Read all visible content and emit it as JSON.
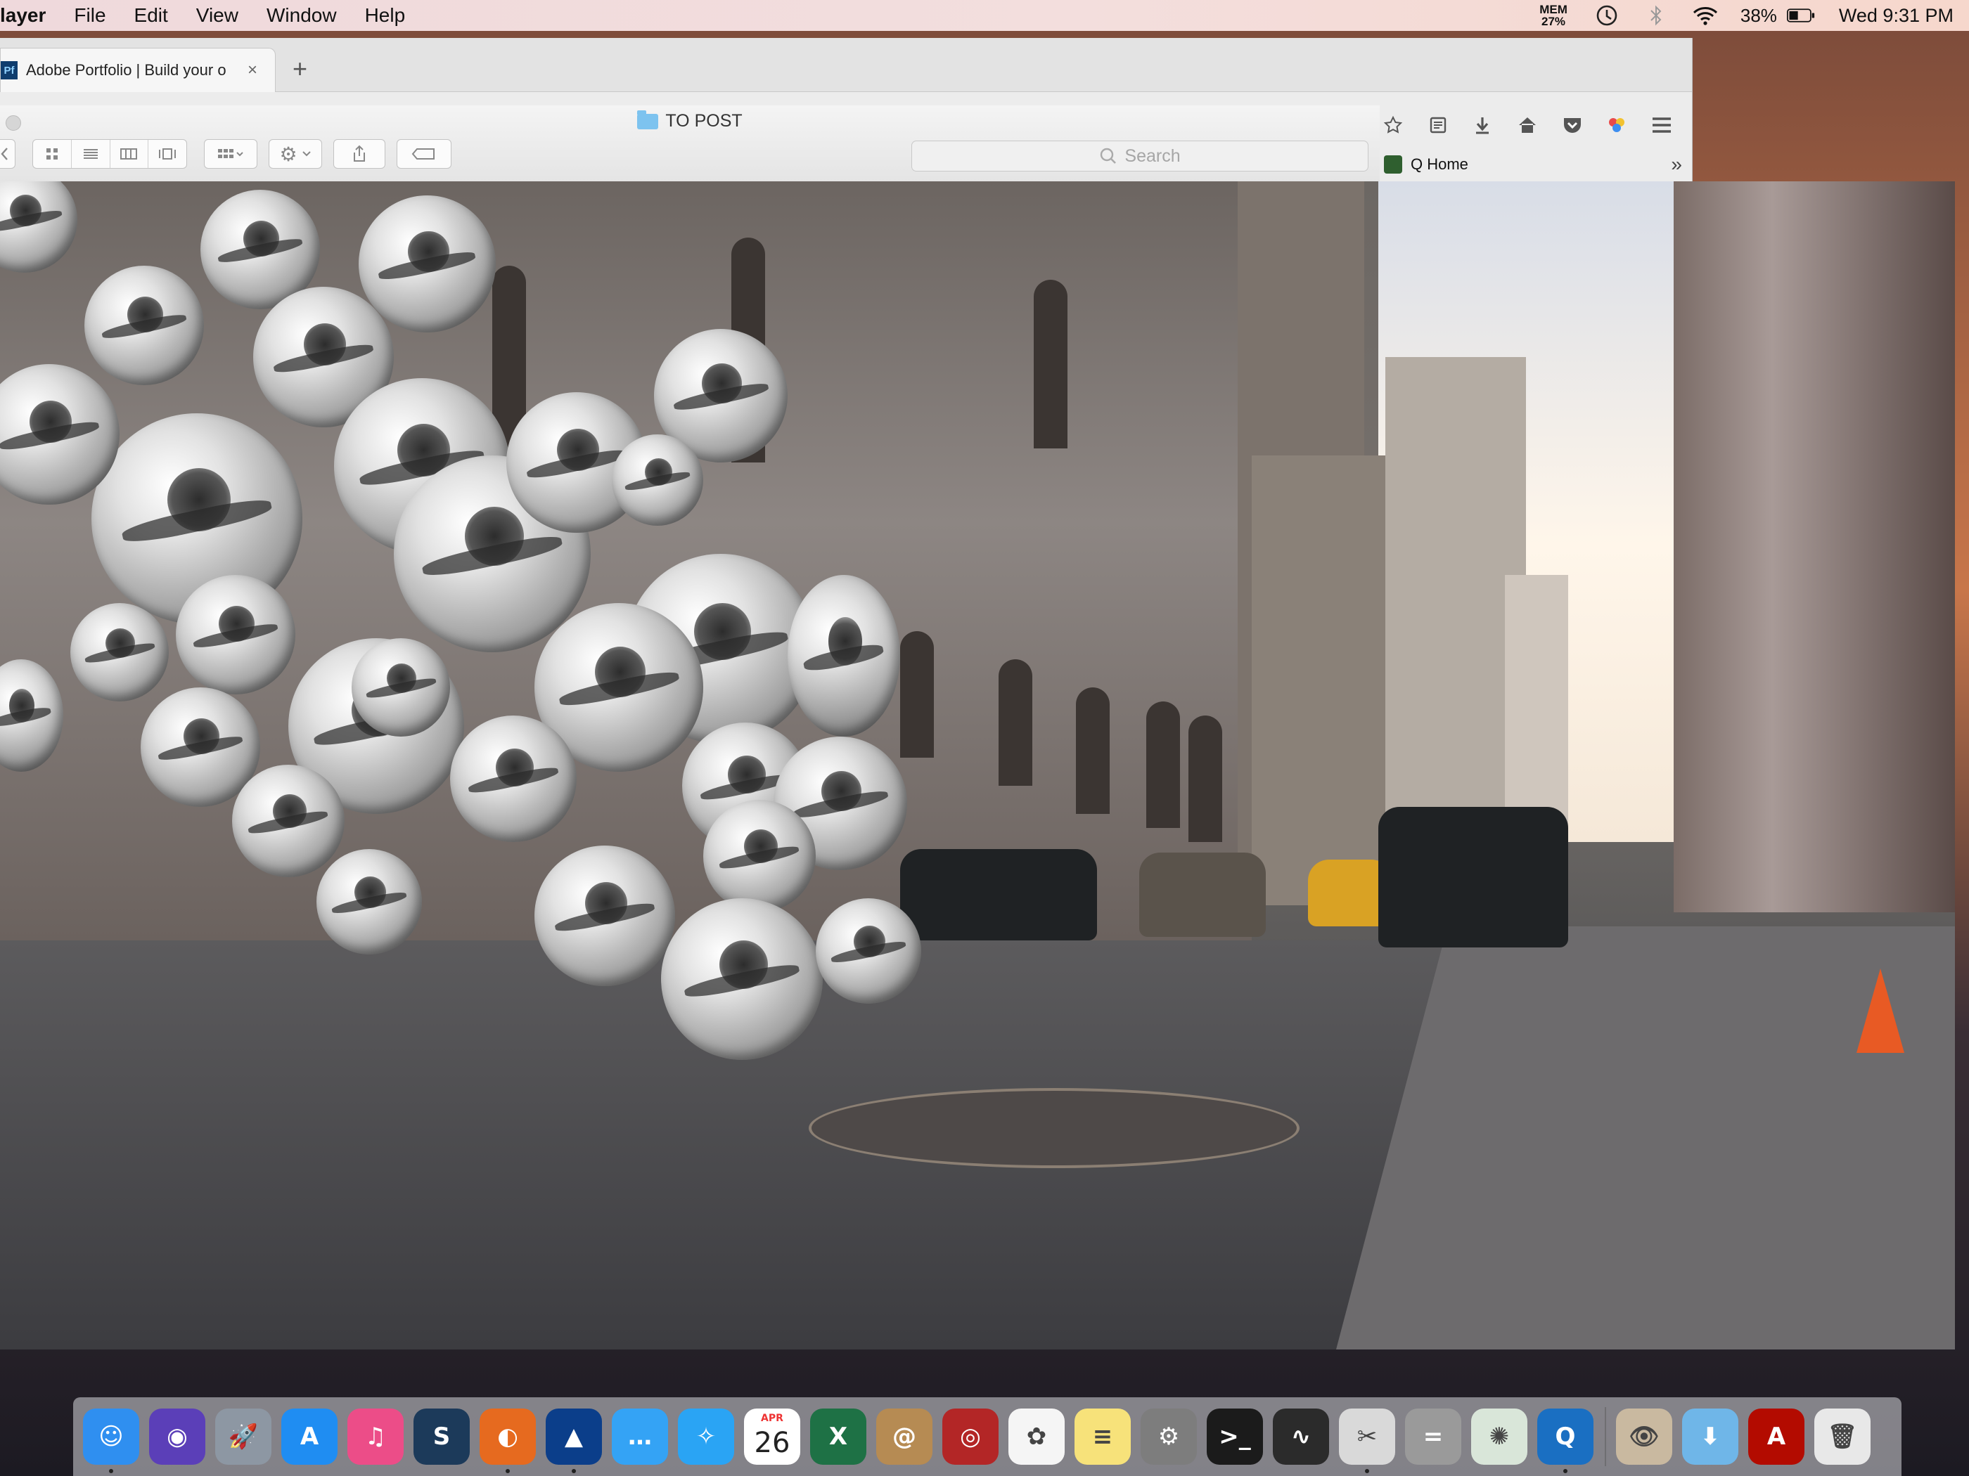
{
  "menubar": {
    "app_name": "layer",
    "items": [
      "File",
      "Edit",
      "View",
      "Window",
      "Help"
    ],
    "mem_label": "MEM",
    "mem_value": "27%",
    "battery_percent": "38%",
    "clock": "Wed 9:31 PM"
  },
  "browser": {
    "tab": {
      "favicon_text": "Pf",
      "title": "Adobe Portfolio | Build your o",
      "close": "×"
    },
    "new_tab": "+",
    "bookmark": {
      "label": "Q Home",
      "overflow": "»"
    },
    "toolbar_icons": [
      "star-icon",
      "reading-list-icon",
      "download-icon",
      "home-icon",
      "pocket-icon",
      "colorful-extension-icon",
      "hamburger-menu-icon"
    ]
  },
  "finder": {
    "title": "TO POST",
    "search_placeholder": "Search",
    "view_modes": [
      "icon-view",
      "list-view",
      "column-view",
      "cover-flow-view"
    ]
  },
  "dock": {
    "calendar_month": "APR",
    "calendar_day": "26",
    "apps": [
      {
        "name": "Finder",
        "color": "#2f8ff0",
        "glyph": "☺",
        "running": true
      },
      {
        "name": "Siri",
        "color": "#5b3fb8",
        "glyph": "◉",
        "running": false
      },
      {
        "name": "Launchpad",
        "color": "#8d97a3",
        "glyph": "🚀",
        "running": false
      },
      {
        "name": "App Store",
        "color": "#1f8df2",
        "glyph": "A",
        "running": false
      },
      {
        "name": "iTunes",
        "color": "#ec4d88",
        "glyph": "♫",
        "running": false
      },
      {
        "name": "Steam",
        "color": "#1c3a5a",
        "glyph": "S",
        "running": false
      },
      {
        "name": "Firefox",
        "color": "#e66a1f",
        "glyph": "◐",
        "running": true
      },
      {
        "name": "Cyberduck",
        "color": "#0b3e8a",
        "glyph": "▲",
        "running": true
      },
      {
        "name": "Messages",
        "color": "#34a3f5",
        "glyph": "…",
        "running": false
      },
      {
        "name": "Safari",
        "color": "#2aa4f4",
        "glyph": "✧",
        "running": false
      },
      {
        "name": "Calendar",
        "color": "#ffffff",
        "glyph": "",
        "running": false
      },
      {
        "name": "Excel",
        "color": "#1e7145",
        "glyph": "X",
        "running": false
      },
      {
        "name": "Contacts",
        "color": "#b68b53",
        "glyph": "@",
        "running": false
      },
      {
        "name": "Photo Booth",
        "color": "#b32626",
        "glyph": "◎",
        "running": false
      },
      {
        "name": "Photos",
        "color": "#f5f5f5",
        "glyph": "✿",
        "running": false
      },
      {
        "name": "Notes",
        "color": "#f7e27a",
        "glyph": "≡",
        "running": false
      },
      {
        "name": "System Preferences",
        "color": "#7d7d7d",
        "glyph": "⚙",
        "running": false
      },
      {
        "name": "Terminal",
        "color": "#1b1b1b",
        "glyph": ">_",
        "running": false
      },
      {
        "name": "Activity Monitor",
        "color": "#2b2b2b",
        "glyph": "∿",
        "running": false
      },
      {
        "name": "Screenshot",
        "color": "#d9d9d9",
        "glyph": "✂",
        "running": true
      },
      {
        "name": "Calculator",
        "color": "#9a9a9a",
        "glyph": "=",
        "running": false
      },
      {
        "name": "Loading",
        "color": "#d9e6d9",
        "glyph": "✺",
        "running": false
      },
      {
        "name": "QuickTime Player",
        "color": "#1a6fc2",
        "glyph": "Q",
        "running": true
      }
    ],
    "docs": [
      {
        "name": "Preview Image",
        "color": "#c9b9a0",
        "glyph": "👁"
      },
      {
        "name": "Downloads",
        "color": "#6fb6e8",
        "glyph": "⬇"
      },
      {
        "name": "Acrobat",
        "color": "#b30b00",
        "glyph": "A"
      },
      {
        "name": "Trash",
        "color": "#e8e8e8",
        "glyph": "🗑"
      }
    ]
  }
}
